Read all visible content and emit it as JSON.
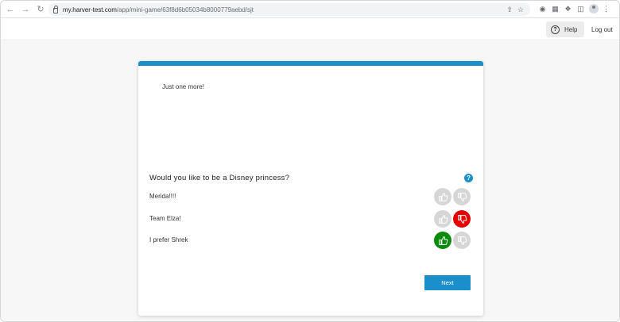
{
  "browser": {
    "url_host": "my.harver-test.com",
    "url_path": "/app/mini-game/63f8d6b05034b8000779aebd/sjt"
  },
  "header": {
    "help_label": "Help",
    "logout_label": "Log out"
  },
  "card": {
    "intro_text": "Just one more!",
    "question": "Would you like to be a Disney princess?",
    "options": [
      {
        "label": "Merida!!!!",
        "selection": "none"
      },
      {
        "label": "Team Elza!",
        "selection": "dislike"
      },
      {
        "label": "I prefer Shrek",
        "selection": "like"
      }
    ],
    "next_label": "Next"
  },
  "colors": {
    "accent": "#1a8fc9",
    "like_selected": "#0b8a0b",
    "dislike_selected": "#e60000",
    "unselected": "#d6d6d6"
  }
}
